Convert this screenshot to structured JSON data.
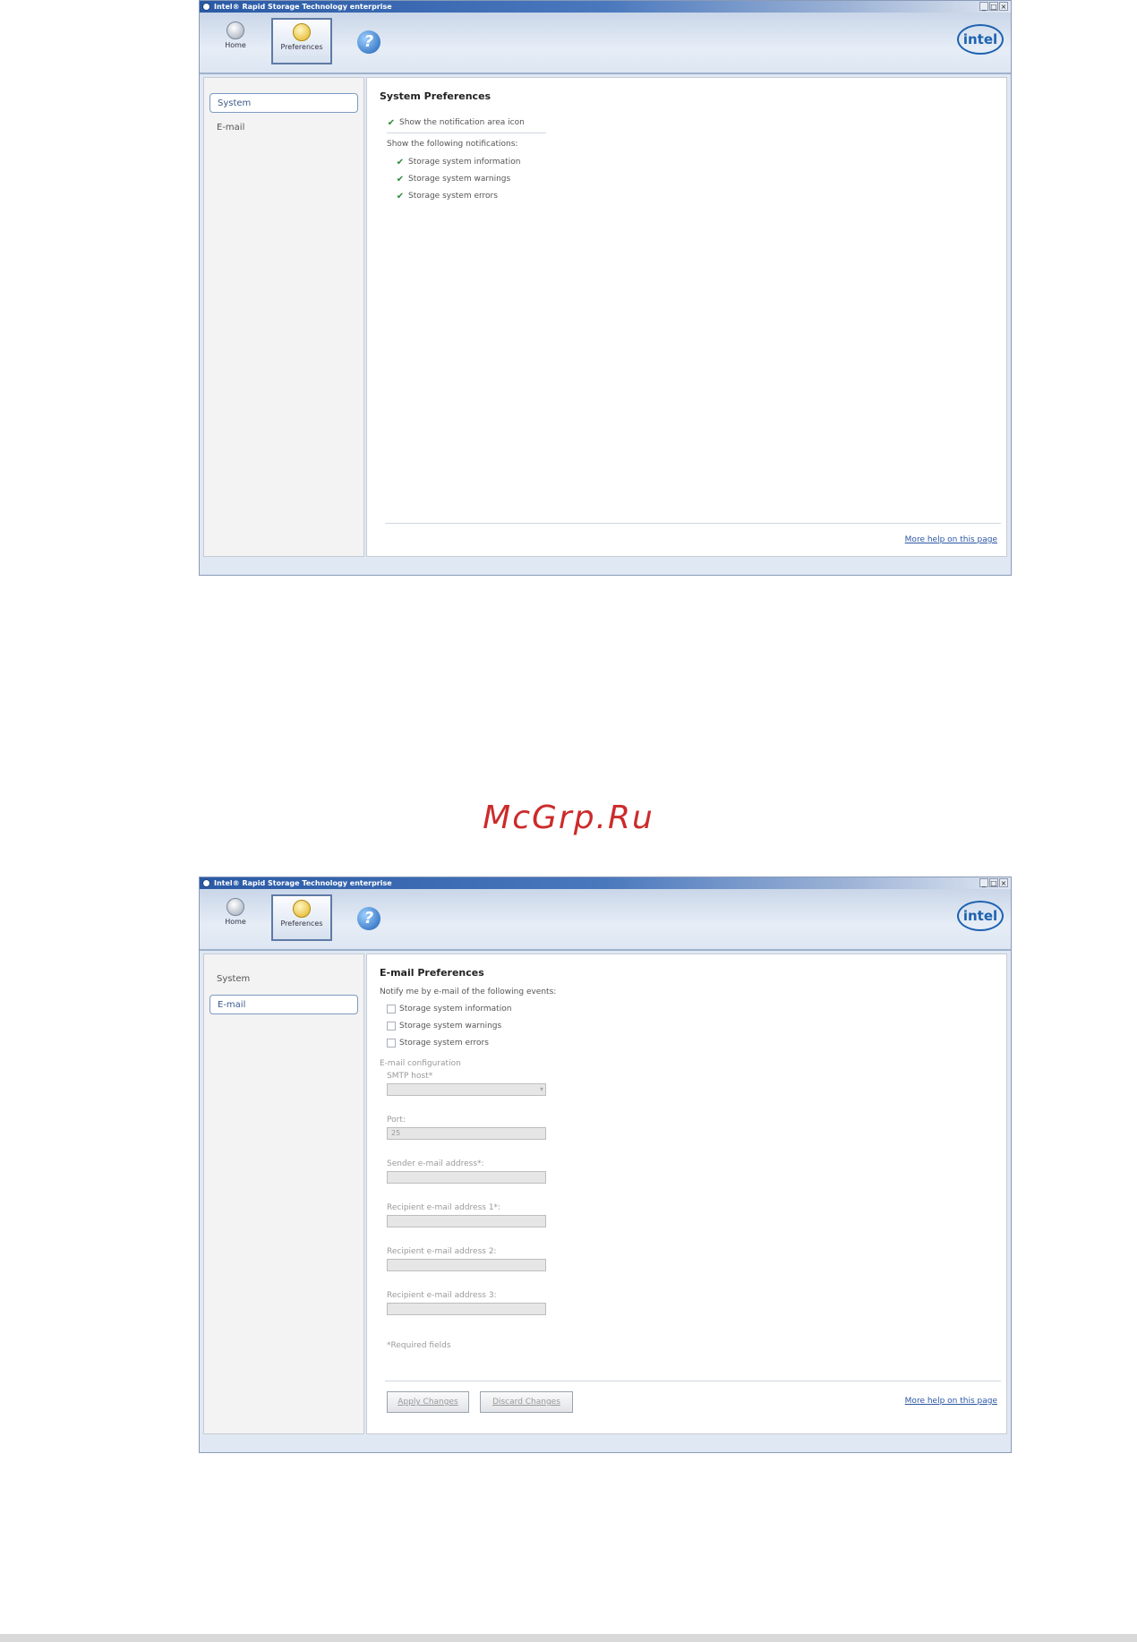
{
  "app": {
    "title": "Intel® Rapid Storage Technology enterprise",
    "window_controls": [
      "_",
      "□",
      "×"
    ],
    "toolbar": {
      "home_label": "Home",
      "preferences_label": "Preferences",
      "help_icon": "help-icon",
      "logo_text": "intel"
    }
  },
  "window1": {
    "sidebar": {
      "items": [
        {
          "label": "System",
          "active": true
        },
        {
          "label": "E-mail",
          "active": false
        }
      ]
    },
    "main": {
      "title": "System Preferences",
      "show_icon": "Show the notification area icon",
      "show_following": "Show the following notifications:",
      "notifications": [
        "Storage system information",
        "Storage system warnings",
        "Storage system errors"
      ],
      "help_link": "More help on this page"
    }
  },
  "window2": {
    "sidebar": {
      "items": [
        {
          "label": "System",
          "active": false
        },
        {
          "label": "E-mail",
          "active": true
        }
      ]
    },
    "main": {
      "title": "E-mail Preferences",
      "notify_text": "Notify me by e-mail of the following events:",
      "events": [
        "Storage system information",
        "Storage system warnings",
        "Storage system errors"
      ],
      "config_title": "E-mail configuration",
      "fields": [
        {
          "label": "SMTP host*",
          "value": ""
        },
        {
          "label": "Port:",
          "value": "25"
        },
        {
          "label": "Sender e-mail address*:",
          "value": ""
        },
        {
          "label": "Recipient e-mail address 1*:",
          "value": ""
        },
        {
          "label": "Recipient e-mail address 2:",
          "value": ""
        },
        {
          "label": "Recipient e-mail address 3:",
          "value": ""
        }
      ],
      "required_note": "*Required fields",
      "apply_button": "Apply Changes",
      "discard_button": "Discard Changes",
      "help_link": "More help on this page"
    }
  },
  "watermark": "McGrp.Ru",
  "colors": {
    "accent": "#1d62b0",
    "watermark": "#cc2b2b",
    "titlebar": "#2a5aa6"
  }
}
